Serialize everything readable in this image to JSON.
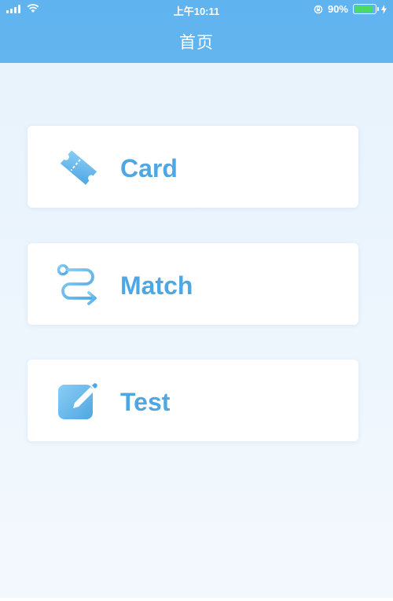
{
  "status_bar": {
    "time": "上午10:11",
    "battery_percent": "90%",
    "battery_level": 0.9
  },
  "header": {
    "title": "首页"
  },
  "menu": [
    {
      "label": "Card",
      "icon": "ticket-icon"
    },
    {
      "label": "Match",
      "icon": "route-arrow-icon"
    },
    {
      "label": "Test",
      "icon": "edit-pencil-icon"
    }
  ],
  "colors": {
    "header": "#5fb3ef",
    "accent": "#4ea7e3",
    "background": "#e9f4fd"
  }
}
